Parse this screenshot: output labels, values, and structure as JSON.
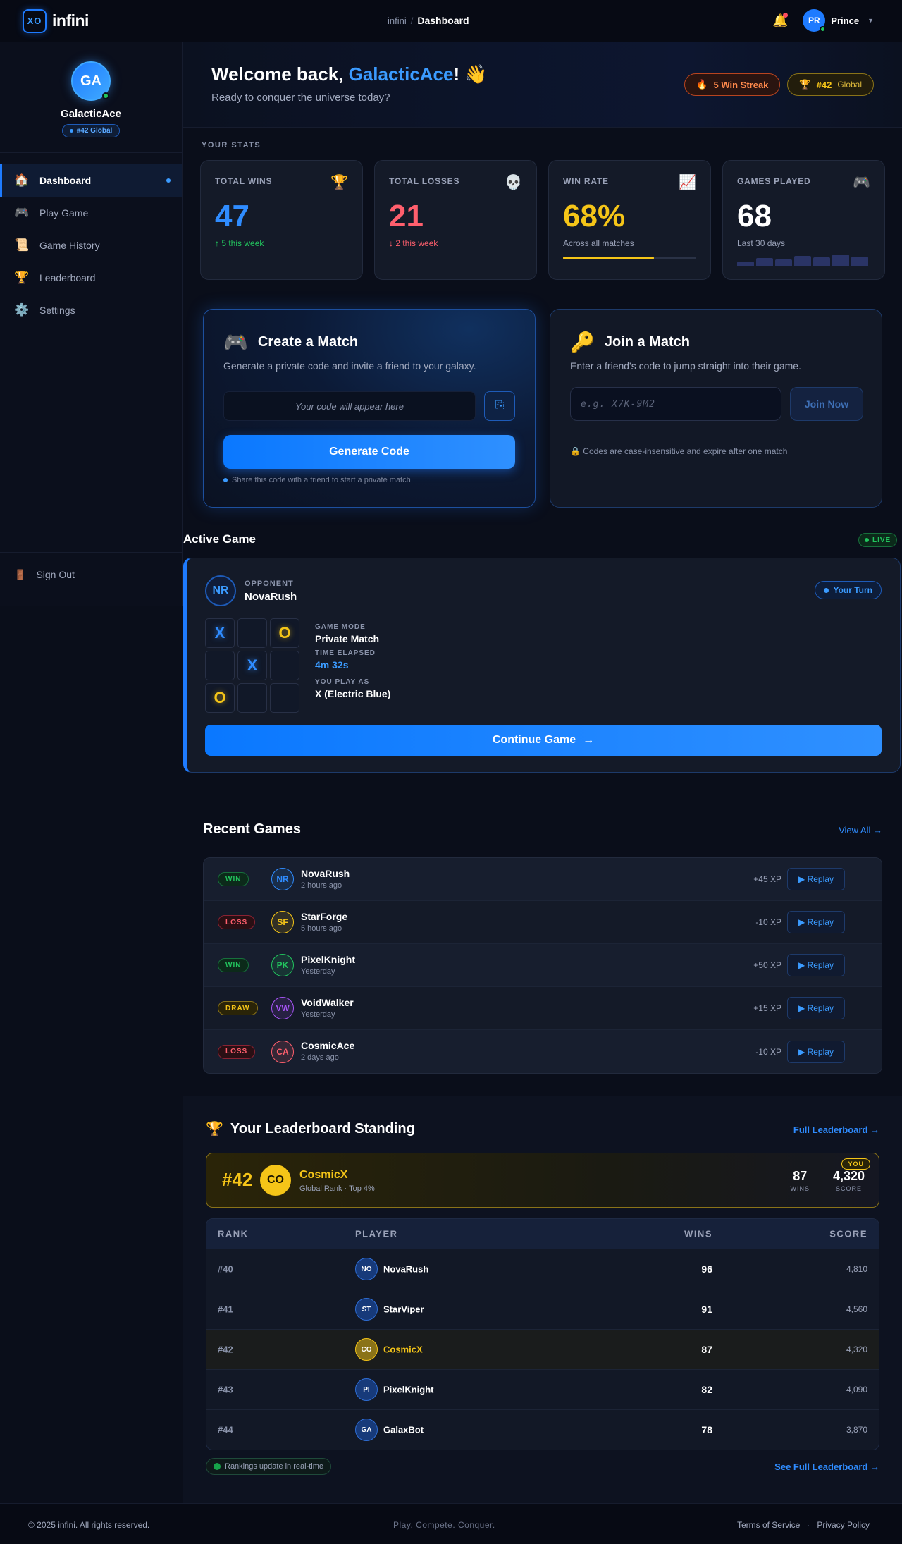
{
  "header": {
    "logo_mark": "XO",
    "logo_text": "infini",
    "breadcrumb": {
      "root": "infini",
      "separator": "/",
      "current": "Dashboard"
    },
    "user": {
      "initials": "PR",
      "name": "Prince"
    }
  },
  "sidebar": {
    "profile": {
      "initials": "GA",
      "name": "GalacticAce",
      "rank": "#42 Global"
    },
    "items": [
      {
        "label": "Dashboard",
        "icon": "house-icon",
        "glyph": "🏠",
        "active": true
      },
      {
        "label": "Play Game",
        "icon": "gamepad-icon",
        "glyph": "🎮"
      },
      {
        "label": "Game History",
        "icon": "scroll-icon",
        "glyph": "📜"
      },
      {
        "label": "Leaderboard",
        "icon": "trophy-icon",
        "glyph": "🏆"
      },
      {
        "label": "Settings",
        "icon": "gear-icon",
        "glyph": "⚙️"
      }
    ],
    "signout": {
      "label": "Sign Out",
      "icon": "door-icon",
      "glyph": "🚪"
    }
  },
  "hero": {
    "greeting_prefix": "Welcome back, ",
    "username": "GalacticAce",
    "greeting_suffix": "!",
    "wave": "👋",
    "subtitle": "Ready to conquer the universe today?",
    "streak": {
      "icon": "🔥",
      "label": "5 Win Streak"
    },
    "global": {
      "icon": "🏆",
      "value": "#42",
      "label": "Global"
    }
  },
  "stats": {
    "section_label": "YOUR STATS",
    "cards": [
      {
        "title": "TOTAL WINS",
        "icon": "🏆",
        "value": "47",
        "sub": "↑ 5 this week"
      },
      {
        "title": "TOTAL LOSSES",
        "icon": "💀",
        "value": "21",
        "sub": "↓ 2 this week"
      },
      {
        "title": "WIN RATE",
        "icon": "📈",
        "value": "68%",
        "sub": "Across all matches",
        "progress": 0.68
      },
      {
        "title": "GAMES PLAYED",
        "icon": "🎮",
        "value": "68",
        "sub": "Last 30 days",
        "bars": [
          0.35,
          0.6,
          0.5,
          0.75,
          0.65,
          0.85,
          0.7
        ]
      }
    ]
  },
  "create_match": {
    "icon": "🎮",
    "title": "Create a Match",
    "description": "Generate a private code and invite a friend to your galaxy.",
    "code_placeholder": "Your code will appear here",
    "copy_icon": "⎘",
    "button": "Generate Code",
    "hint": "Share this code with a friend to start a private match"
  },
  "join_match": {
    "icon": "🔑",
    "title": "Join a Match",
    "description": "Enter a friend's code to jump straight into their game.",
    "input_placeholder": "e.g. X7K-9M2",
    "button": "Join Now",
    "note": "🔒 Codes are case-insensitive and expire after one match"
  },
  "active_game": {
    "title": "Active Game",
    "live": "LIVE",
    "opponent_label": "OPPONENT",
    "opponent_initials": "NR",
    "opponent_name": "NovaRush",
    "turn": "Your Turn",
    "board": [
      "X",
      "",
      "O",
      "",
      "X",
      "",
      "O",
      "",
      ""
    ],
    "info": [
      {
        "label": "GAME MODE",
        "value": "Private Match"
      },
      {
        "label": "TIME ELAPSED",
        "value": "4m 32s"
      },
      {
        "label": "YOU PLAY AS",
        "value": "X (Electric Blue)"
      }
    ],
    "button": "Continue Game",
    "button_arrow": "→"
  },
  "recent_games": {
    "title": "Recent Games",
    "view_all": "View All →",
    "rows": [
      {
        "result": "WIN",
        "initials": "NR",
        "name": "NovaRush",
        "time": "2 hours ago",
        "xp": "+45 XP",
        "color": "#2f8cff"
      },
      {
        "result": "LOSS",
        "initials": "SF",
        "name": "StarForge",
        "time": "5 hours ago",
        "xp": "-10 XP",
        "color": "#f5c518"
      },
      {
        "result": "WIN",
        "initials": "PK",
        "name": "PixelKnight",
        "time": "Yesterday",
        "xp": "+50 XP",
        "color": "#22c55e"
      },
      {
        "result": "DRAW",
        "initials": "VW",
        "name": "VoidWalker",
        "time": "Yesterday",
        "xp": "+15 XP",
        "color": "#a855f7"
      },
      {
        "result": "LOSS",
        "initials": "CA",
        "name": "CosmicAce",
        "time": "2 days ago",
        "xp": "-10 XP",
        "color": "#ff5f6d"
      }
    ],
    "replay_label": "▶ Replay"
  },
  "leaderboard": {
    "icon": "🏆",
    "title": "Your Leaderboard Standing",
    "full_link": "Full Leaderboard →",
    "you": {
      "rank": "#42",
      "initials": "CO",
      "name": "CosmicX",
      "sub": "Global Rank · Top 4%",
      "tag": "YOU",
      "wins": "87",
      "wins_label": "WINS",
      "score": "4,320",
      "score_label": "SCORE"
    },
    "columns": [
      "RANK",
      "PLAYER",
      "WINS",
      "SCORE"
    ],
    "rows": [
      {
        "rank": "#40",
        "initials": "NO",
        "name": "NovaRush",
        "wins": "96",
        "score": "4,810"
      },
      {
        "rank": "#41",
        "initials": "ST",
        "name": "StarViper",
        "wins": "91",
        "score": "4,560"
      },
      {
        "rank": "#42",
        "initials": "CO",
        "name": "CosmicX",
        "wins": "87",
        "score": "4,320",
        "me": true
      },
      {
        "rank": "#43",
        "initials": "PI",
        "name": "PixelKnight",
        "wins": "82",
        "score": "4,090"
      },
      {
        "rank": "#44",
        "initials": "GA",
        "name": "GalaxBot",
        "wins": "78",
        "score": "3,870"
      }
    ],
    "realtime": "Rankings update in real-time",
    "see_full": "See Full Leaderboard →"
  },
  "footer": {
    "copyright": "© 2025 infini. All rights reserved.",
    "tagline": "Play. Compete. Conquer.",
    "links": [
      "Terms of Service",
      "Privacy Policy"
    ],
    "separator": "·"
  }
}
